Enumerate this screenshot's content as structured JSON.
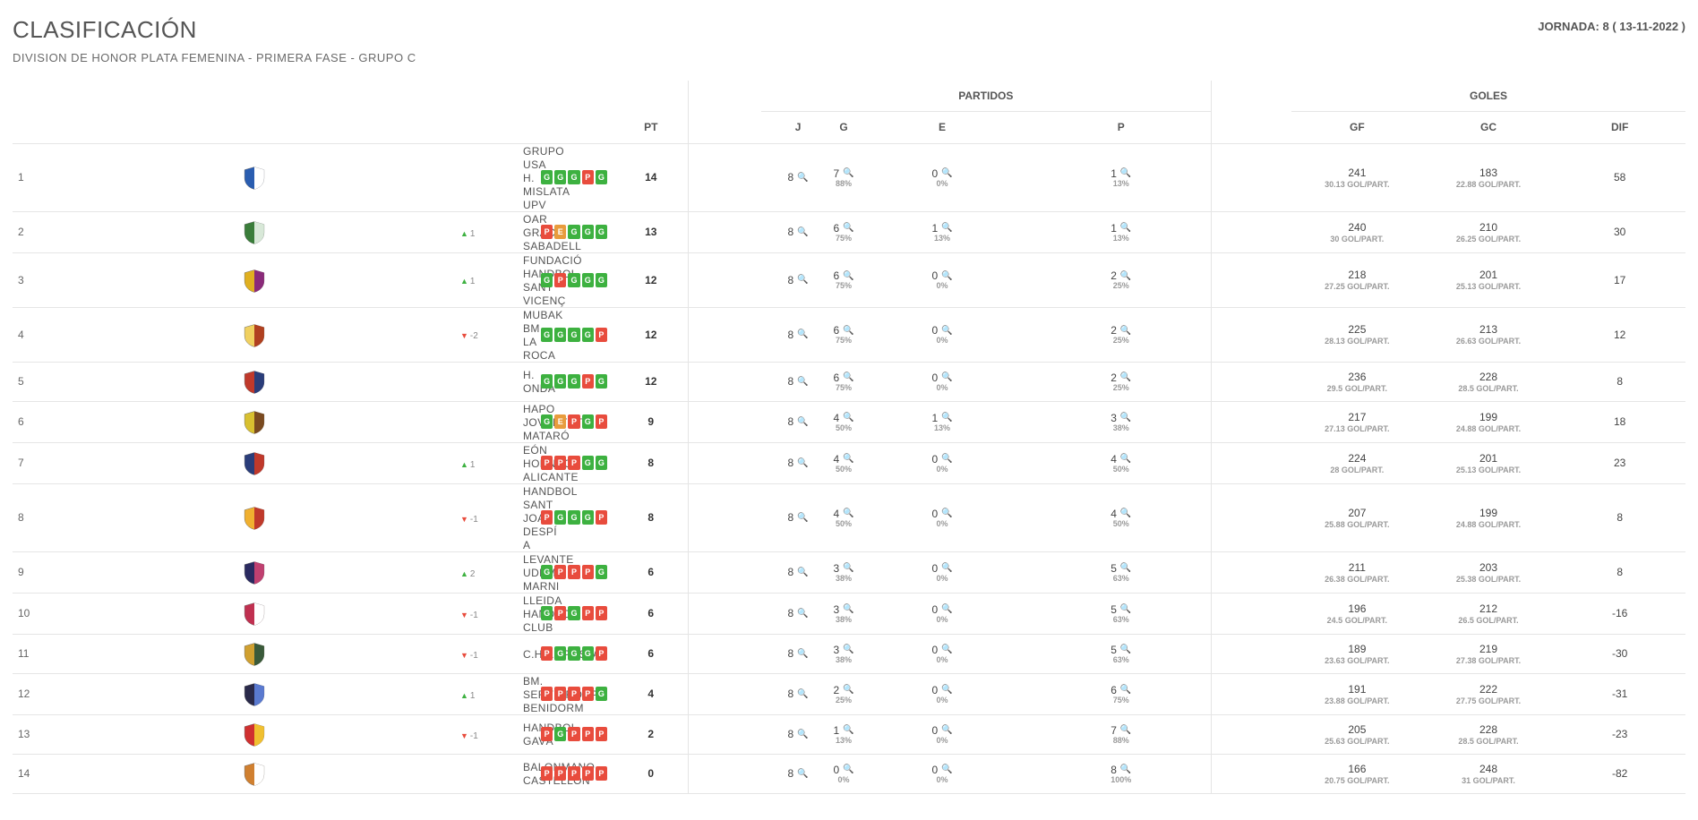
{
  "header": {
    "title": "CLASIFICACIÓN",
    "subtitle": "DIVISION DE HONOR PLATA FEMENINA - PRIMERA FASE - GRUPO C",
    "jornada": "JORNADA: 8 ( 13-11-2022 )"
  },
  "groups": {
    "partidos": "PARTIDOS",
    "goles": "GOLES"
  },
  "columns": {
    "pt": "PT",
    "j": "J",
    "g": "G",
    "e": "E",
    "p": "P",
    "gf": "GF",
    "gc": "GC",
    "dif": "DIF"
  },
  "shieldColors": [
    [
      "#2a5db0",
      "#ffffff"
    ],
    [
      "#3a7d3a",
      "#d8e8d8"
    ],
    [
      "#e0b020",
      "#8a2a7a"
    ],
    [
      "#f0d060",
      "#b04020"
    ],
    [
      "#c0392b",
      "#2a3d7a"
    ],
    [
      "#d8c030",
      "#7a4a20"
    ],
    [
      "#2a3d7a",
      "#c0392b"
    ],
    [
      "#f0b030",
      "#c0392b"
    ],
    [
      "#2a2a60",
      "#c04070"
    ],
    [
      "#c03050",
      "#ffffff"
    ],
    [
      "#d0a030",
      "#3a5a3a"
    ],
    [
      "#2a2a4a",
      "#5a7ad0"
    ],
    [
      "#d03030",
      "#f0c030"
    ],
    [
      "#d08030",
      "#ffffff"
    ]
  ],
  "rows": [
    {
      "pos": 1,
      "move": null,
      "team": "GRUPO USA H. MISLATA UPV",
      "streak": [
        "G",
        "G",
        "G",
        "P",
        "G"
      ],
      "pt": 14,
      "j": 8,
      "g": {
        "v": 7,
        "p": "88%"
      },
      "e": {
        "v": 0,
        "p": "0%"
      },
      "p": {
        "v": 1,
        "p": "13%"
      },
      "gf": {
        "v": 241,
        "s": "30.13 GOL/PART."
      },
      "gc": {
        "v": 183,
        "s": "22.88 GOL/PART."
      },
      "dif": 58
    },
    {
      "pos": 2,
      "move": {
        "dir": "up",
        "n": 1
      },
      "team": "OAR GRACIA SABADELL",
      "streak": [
        "P",
        "E",
        "G",
        "G",
        "G"
      ],
      "pt": 13,
      "j": 8,
      "g": {
        "v": 6,
        "p": "75%"
      },
      "e": {
        "v": 1,
        "p": "13%"
      },
      "p": {
        "v": 1,
        "p": "13%"
      },
      "gf": {
        "v": 240,
        "s": "30 GOL/PART."
      },
      "gc": {
        "v": 210,
        "s": "26.25 GOL/PART."
      },
      "dif": 30
    },
    {
      "pos": 3,
      "move": {
        "dir": "up",
        "n": 1
      },
      "team": "FUNDACIÓ HANDBOL SANT VICENÇ",
      "streak": [
        "G",
        "P",
        "G",
        "G",
        "G"
      ],
      "pt": 12,
      "j": 8,
      "g": {
        "v": 6,
        "p": "75%"
      },
      "e": {
        "v": 0,
        "p": "0%"
      },
      "p": {
        "v": 2,
        "p": "25%"
      },
      "gf": {
        "v": 218,
        "s": "27.25 GOL/PART."
      },
      "gc": {
        "v": 201,
        "s": "25.13 GOL/PART."
      },
      "dif": 17
    },
    {
      "pos": 4,
      "move": {
        "dir": "down",
        "n": 2
      },
      "team": "MUBAK BM LA ROCA",
      "streak": [
        "G",
        "G",
        "G",
        "G",
        "P"
      ],
      "pt": 12,
      "j": 8,
      "g": {
        "v": 6,
        "p": "75%"
      },
      "e": {
        "v": 0,
        "p": "0%"
      },
      "p": {
        "v": 2,
        "p": "25%"
      },
      "gf": {
        "v": 225,
        "s": "28.13 GOL/PART."
      },
      "gc": {
        "v": 213,
        "s": "26.63 GOL/PART."
      },
      "dif": 12
    },
    {
      "pos": 5,
      "move": null,
      "team": "H. ONDA",
      "streak": [
        "G",
        "G",
        "G",
        "P",
        "G"
      ],
      "pt": 12,
      "j": 8,
      "g": {
        "v": 6,
        "p": "75%"
      },
      "e": {
        "v": 0,
        "p": "0%"
      },
      "p": {
        "v": 2,
        "p": "25%"
      },
      "gf": {
        "v": 236,
        "s": "29.5 GOL/PART."
      },
      "gc": {
        "v": 228,
        "s": "28.5 GOL/PART."
      },
      "dif": 8
    },
    {
      "pos": 6,
      "move": null,
      "team": "HAPO JOVENTUT MATARÓ",
      "streak": [
        "G",
        "E",
        "P",
        "G",
        "P"
      ],
      "pt": 9,
      "j": 8,
      "g": {
        "v": 4,
        "p": "50%"
      },
      "e": {
        "v": 1,
        "p": "13%"
      },
      "p": {
        "v": 3,
        "p": "38%"
      },
      "gf": {
        "v": 217,
        "s": "27.13 GOL/PART."
      },
      "gc": {
        "v": 199,
        "s": "24.88 GOL/PART."
      },
      "dif": 18
    },
    {
      "pos": 7,
      "move": {
        "dir": "up",
        "n": 1
      },
      "team": "EÓN HORNEO ALICANTE",
      "streak": [
        "P",
        "P",
        "P",
        "G",
        "G"
      ],
      "pt": 8,
      "j": 8,
      "g": {
        "v": 4,
        "p": "50%"
      },
      "e": {
        "v": 0,
        "p": "0%"
      },
      "p": {
        "v": 4,
        "p": "50%"
      },
      "gf": {
        "v": 224,
        "s": "28 GOL/PART."
      },
      "gc": {
        "v": 201,
        "s": "25.13 GOL/PART."
      },
      "dif": 23
    },
    {
      "pos": 8,
      "move": {
        "dir": "down",
        "n": 1
      },
      "team": "HANDBOL SANT JOAN DESPÍ A",
      "streak": [
        "P",
        "G",
        "G",
        "G",
        "P"
      ],
      "pt": 8,
      "j": 8,
      "g": {
        "v": 4,
        "p": "50%"
      },
      "e": {
        "v": 0,
        "p": "0%"
      },
      "p": {
        "v": 4,
        "p": "50%"
      },
      "gf": {
        "v": 207,
        "s": "25.88 GOL/PART."
      },
      "gc": {
        "v": 199,
        "s": "24.88 GOL/PART."
      },
      "dif": 8
    },
    {
      "pos": 9,
      "move": {
        "dir": "up",
        "n": 2
      },
      "team": "LEVANTE UDBM MARNI",
      "streak": [
        "G",
        "P",
        "P",
        "P",
        "G"
      ],
      "pt": 6,
      "j": 8,
      "g": {
        "v": 3,
        "p": "38%"
      },
      "e": {
        "v": 0,
        "p": "0%"
      },
      "p": {
        "v": 5,
        "p": "63%"
      },
      "gf": {
        "v": 211,
        "s": "26.38 GOL/PART."
      },
      "gc": {
        "v": 203,
        "s": "25.38 GOL/PART."
      },
      "dif": 8
    },
    {
      "pos": 10,
      "move": {
        "dir": "down",
        "n": 1
      },
      "team": "LLEIDA HANDBOL CLUB",
      "streak": [
        "G",
        "P",
        "G",
        "P",
        "P"
      ],
      "pt": 6,
      "j": 8,
      "g": {
        "v": 3,
        "p": "38%"
      },
      "e": {
        "v": 0,
        "p": "0%"
      },
      "p": {
        "v": 5,
        "p": "63%"
      },
      "gf": {
        "v": 196,
        "s": "24.5 GOL/PART."
      },
      "gc": {
        "v": 212,
        "s": "26.5 GOL/PART."
      },
      "dif": -16
    },
    {
      "pos": 11,
      "move": {
        "dir": "down",
        "n": 1
      },
      "team": "C.H.AMPOSTA",
      "streak": [
        "P",
        "G",
        "G",
        "G",
        "P"
      ],
      "pt": 6,
      "j": 8,
      "g": {
        "v": 3,
        "p": "38%"
      },
      "e": {
        "v": 0,
        "p": "0%"
      },
      "p": {
        "v": 5,
        "p": "63%"
      },
      "gf": {
        "v": 189,
        "s": "23.63 GOL/PART."
      },
      "gc": {
        "v": 219,
        "s": "27.38 GOL/PART."
      },
      "dif": -30
    },
    {
      "pos": 12,
      "move": {
        "dir": "up",
        "n": 1
      },
      "team": "BM. SERVIGROUP BENIDORM",
      "streak": [
        "P",
        "P",
        "P",
        "P",
        "G"
      ],
      "pt": 4,
      "j": 8,
      "g": {
        "v": 2,
        "p": "25%"
      },
      "e": {
        "v": 0,
        "p": "0%"
      },
      "p": {
        "v": 6,
        "p": "75%"
      },
      "gf": {
        "v": 191,
        "s": "23.88 GOL/PART."
      },
      "gc": {
        "v": 222,
        "s": "27.75 GOL/PART."
      },
      "dif": -31
    },
    {
      "pos": 13,
      "move": {
        "dir": "down",
        "n": 1
      },
      "team": "HANDBOL GAVÀ",
      "streak": [
        "P",
        "G",
        "P",
        "P",
        "P"
      ],
      "pt": 2,
      "j": 8,
      "g": {
        "v": 1,
        "p": "13%"
      },
      "e": {
        "v": 0,
        "p": "0%"
      },
      "p": {
        "v": 7,
        "p": "88%"
      },
      "gf": {
        "v": 205,
        "s": "25.63 GOL/PART."
      },
      "gc": {
        "v": 228,
        "s": "28.5 GOL/PART."
      },
      "dif": -23
    },
    {
      "pos": 14,
      "move": null,
      "team": "BALONMANO CASTELLON",
      "streak": [
        "P",
        "P",
        "P",
        "P",
        "P"
      ],
      "pt": 0,
      "j": 8,
      "g": {
        "v": 0,
        "p": "0%"
      },
      "e": {
        "v": 0,
        "p": "0%"
      },
      "p": {
        "v": 8,
        "p": "100%"
      },
      "gf": {
        "v": 166,
        "s": "20.75 GOL/PART."
      },
      "gc": {
        "v": 248,
        "s": "31 GOL/PART."
      },
      "dif": -82
    }
  ]
}
